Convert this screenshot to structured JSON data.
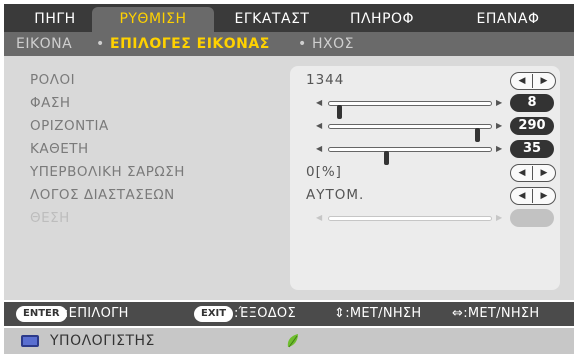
{
  "tabs": [
    {
      "label": "ΠΗΓΗ",
      "active": false
    },
    {
      "label": "ΡΥΘΜΙΣΗ",
      "active": true
    },
    {
      "label": "ΕΓΚΑΤΑΣΤ",
      "active": false
    },
    {
      "label": "ΠΛΗΡΟΦ",
      "active": false
    },
    {
      "label": "ΕΠΑΝΑΦ",
      "active": false
    }
  ],
  "subtabs": [
    {
      "label": "ΕΙΚΟΝΑ",
      "active": false
    },
    {
      "label": "ΕΠΙΛΟΓΕΣ ΕΙΚΟΝΑΣ",
      "active": true
    },
    {
      "label": "ΗΧΟΣ",
      "active": false
    }
  ],
  "subtab_separator": "•",
  "settings": [
    {
      "label": "ΡΟΛΟΙ",
      "value": "1344",
      "control": "spinner"
    },
    {
      "label": "ΦΑΣΗ",
      "value": "8",
      "control": "slider",
      "level": 0.05
    },
    {
      "label": "ΟΡΙΖΟΝΤΙΑ",
      "value": "290",
      "control": "slider",
      "level": 0.93
    },
    {
      "label": "ΚΑΘΕΤΗ",
      "value": "35",
      "control": "slider",
      "level": 0.35
    },
    {
      "label": "ΥΠΕΡΒΟΛΙΚΗ ΣΑΡΩΣΗ",
      "value": "0[%]",
      "control": "spinner"
    },
    {
      "label": "ΛΟΓΟΣ ΔΙΑΣΤΑΣΕΩΝ",
      "value": "ΑΥΤΟΜ.",
      "control": "spinner"
    },
    {
      "label": "ΘΕΣΗ",
      "value": "",
      "control": "slider",
      "level": null,
      "disabled": true
    }
  ],
  "help": {
    "enter_key": "ENTER",
    "enter_text": ":ΕΠΙΛΟΓΗ",
    "exit_key": "EXIT",
    "exit_text": ":ΈΞΟΔΟΣ",
    "move_text": "⇕:ΜΕΤ/ΝΗΣΗ",
    "nav_text": "⇔:ΜΕΤ/ΝΗΣΗ"
  },
  "status": {
    "source": "ΥΠΟΛΟΓΙΣΤΗΣ",
    "source_icon": "computer-monitor-icon",
    "eco_icon": "eco-leaf-icon"
  },
  "colors": {
    "active_text": "#ffd200",
    "eco_leaf": "#6fbe2e"
  }
}
